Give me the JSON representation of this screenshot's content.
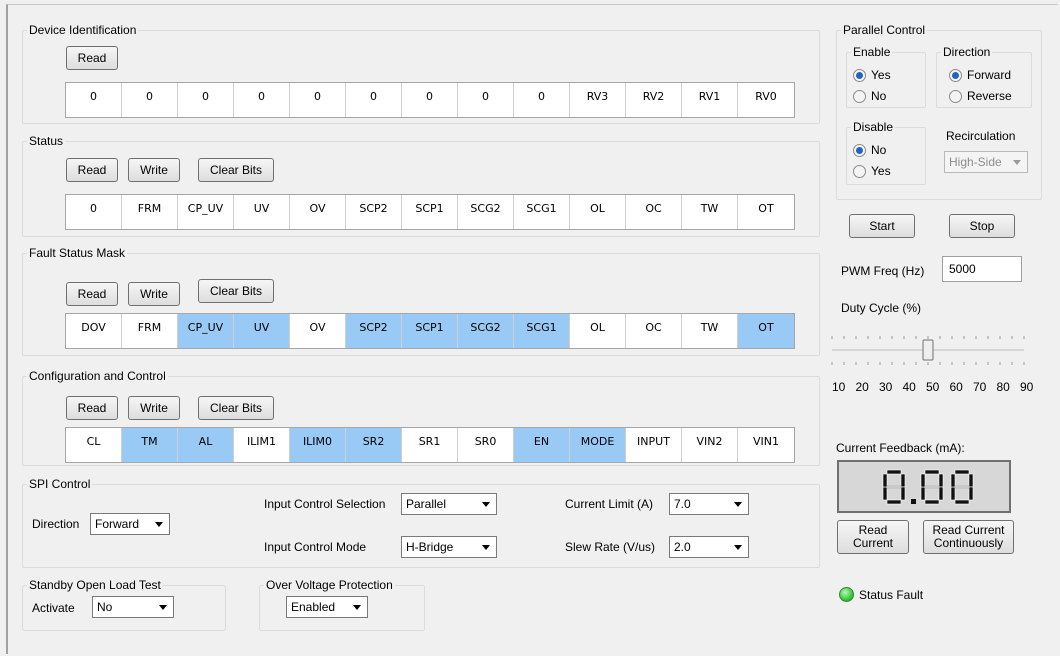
{
  "device_identification": {
    "title": "Device Identification",
    "read_label": "Read",
    "cells": [
      "0",
      "0",
      "0",
      "0",
      "0",
      "0",
      "0",
      "0",
      "0",
      "RV3",
      "RV2",
      "RV1",
      "RV0"
    ]
  },
  "status": {
    "title": "Status",
    "read_label": "Read",
    "write_label": "Write",
    "clear_label": "Clear Bits",
    "cells": [
      "0",
      "FRM",
      "CP_UV",
      "UV",
      "OV",
      "SCP2",
      "SCP1",
      "SCG2",
      "SCG1",
      "OL",
      "OC",
      "TW",
      "OT"
    ]
  },
  "fault_mask": {
    "title": "Fault Status Mask",
    "read_label": "Read",
    "write_label": "Write",
    "clear_label": "Clear Bits",
    "cells": [
      "DOV",
      "FRM",
      "CP_UV",
      "UV",
      "OV",
      "SCP2",
      "SCP1",
      "SCG2",
      "SCG1",
      "OL",
      "OC",
      "TW",
      "OT"
    ],
    "highlighted": [
      false,
      false,
      true,
      true,
      false,
      true,
      true,
      true,
      true,
      false,
      false,
      false,
      true
    ]
  },
  "config": {
    "title": "Configuration and Control",
    "read_label": "Read",
    "write_label": "Write",
    "clear_label": "Clear Bits",
    "cells": [
      "CL",
      "TM",
      "AL",
      "ILIM1",
      "ILIM0",
      "SR2",
      "SR1",
      "SR0",
      "EN",
      "MODE",
      "INPUT",
      "VIN2",
      "VIN1"
    ],
    "highlighted": [
      false,
      true,
      true,
      false,
      true,
      true,
      false,
      false,
      true,
      true,
      false,
      false,
      false
    ]
  },
  "spi": {
    "title": "SPI Control",
    "direction_label": "Direction",
    "direction_value": "Forward",
    "input_selection_label": "Input Control Selection",
    "input_selection_value": "Parallel",
    "input_mode_label": "Input Control Mode",
    "input_mode_value": "H-Bridge",
    "current_limit_label": "Current Limit (A)",
    "current_limit_value": "7.0",
    "slew_rate_label": "Slew Rate (V/us)",
    "slew_rate_value": "2.0"
  },
  "standby": {
    "title": "Standby Open Load Test",
    "activate_label": "Activate",
    "activate_value": "No"
  },
  "ovp": {
    "title": "Over Voltage Protection",
    "value": "Enabled"
  },
  "parallel": {
    "title": "Parallel Control",
    "enable_title": "Enable",
    "enable_yes": "Yes",
    "enable_no": "No",
    "direction_title": "Direction",
    "direction_forward": "Forward",
    "direction_reverse": "Reverse",
    "disable_title": "Disable",
    "disable_no": "No",
    "disable_yes": "Yes",
    "recirc_title": "Recirculation",
    "recirc_value": "High-Side",
    "start_label": "Start",
    "stop_label": "Stop",
    "pwm_label": "PWM Freq (Hz)",
    "pwm_value": "5000",
    "duty_label": "Duty Cycle (%)",
    "duty_ticks": [
      "10",
      "20",
      "30",
      "40",
      "50",
      "60",
      "70",
      "80",
      "90"
    ],
    "duty_value": 50
  },
  "feedback": {
    "label": "Current Feedback (mA):",
    "lcd_value": "0.00",
    "read_label": "Read\nCurrent",
    "read_cont_label": "Read Current\nContinuously",
    "status_label": "Status Fault",
    "status_color": "#3cc83c"
  },
  "colors": {
    "highlight": "#99c9f5",
    "radio_fill": "#1f63c8"
  }
}
